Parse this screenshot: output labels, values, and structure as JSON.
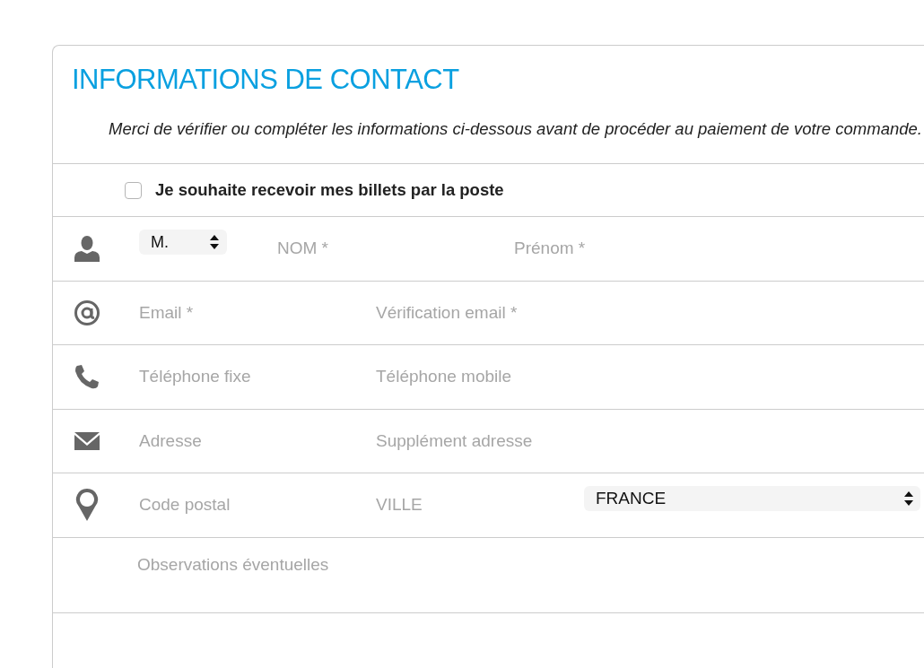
{
  "title": "INFORMATIONS DE CONTACT",
  "intro": "Merci de vérifier ou compléter les informations ci-dessous avant de procéder au paiement de votre commande.",
  "postal_option": {
    "label": "Je souhaite recevoir mes billets par la poste",
    "checked": false
  },
  "rows": [
    {
      "kind": "identity",
      "civility": {
        "value": "M."
      },
      "fields": [
        {
          "placeholder": "NOM *"
        },
        {
          "placeholder": "Prénom *"
        }
      ]
    },
    {
      "kind": "email",
      "fields": [
        {
          "placeholder": "Email *"
        },
        {
          "placeholder": "Vérification email *"
        }
      ]
    },
    {
      "kind": "phone",
      "fields": [
        {
          "placeholder": "Téléphone fixe"
        },
        {
          "placeholder": "Téléphone mobile"
        }
      ]
    },
    {
      "kind": "address",
      "fields": [
        {
          "placeholder": "Adresse"
        },
        {
          "placeholder": "Supplément adresse"
        }
      ]
    },
    {
      "kind": "location",
      "fields": [
        {
          "placeholder": "Code postal"
        },
        {
          "placeholder": "VILLE"
        }
      ],
      "country": {
        "value": "FRANCE"
      }
    }
  ],
  "observations": {
    "placeholder": "Observations éventuelles"
  }
}
